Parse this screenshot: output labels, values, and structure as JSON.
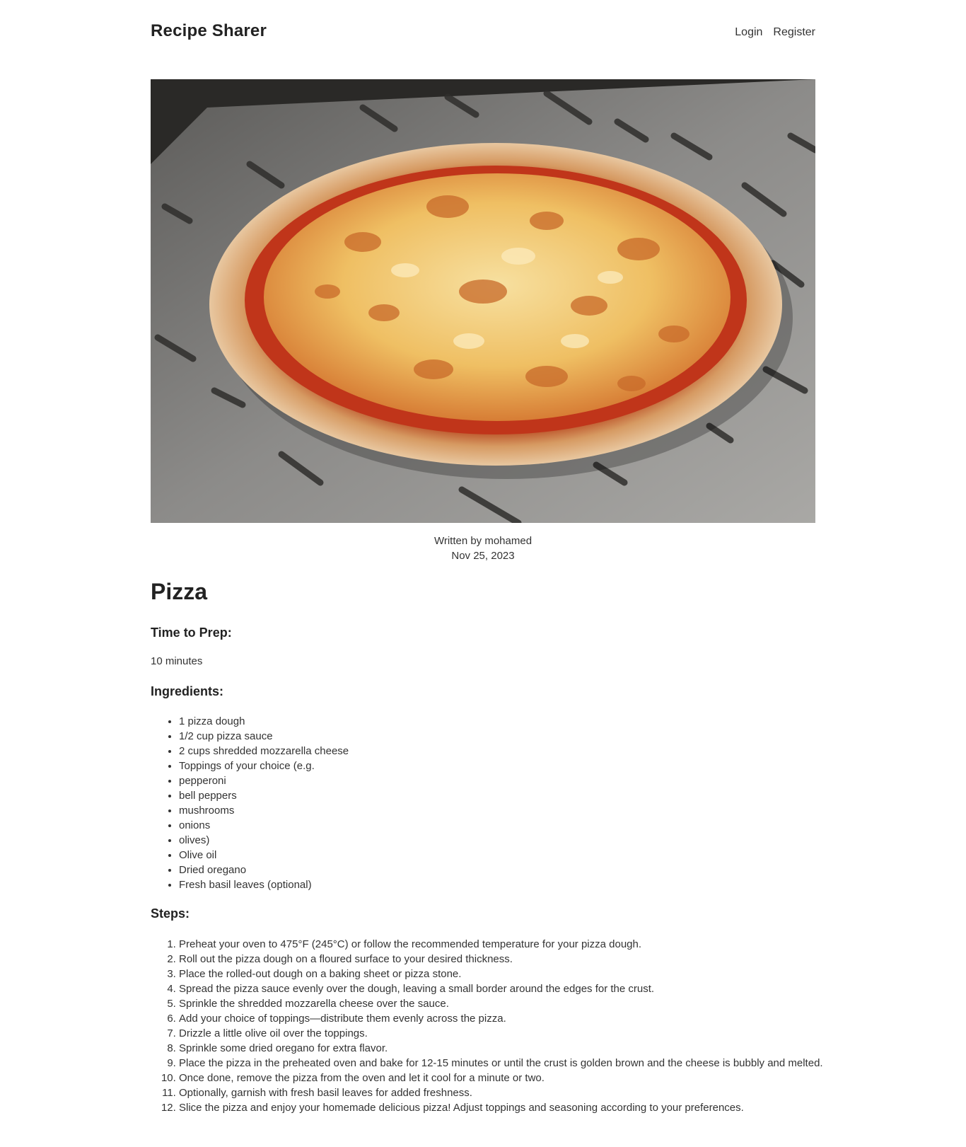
{
  "header": {
    "brand": "Recipe Sharer",
    "nav": {
      "login": "Login",
      "register": "Register"
    }
  },
  "recipe": {
    "image_alt": "Pizza",
    "author_line": "Written by mohamed",
    "date": "Nov 25, 2023",
    "title": "Pizza",
    "prep_heading": "Time to Prep:",
    "prep_time": "10 minutes",
    "ingredients_heading": "Ingredients:",
    "ingredients": [
      "1 pizza dough",
      "1/2 cup pizza sauce",
      "2 cups shredded mozzarella cheese",
      "Toppings of your choice (e.g.",
      "pepperoni",
      "bell peppers",
      "mushrooms",
      "onions",
      "olives)",
      "Olive oil",
      "Dried oregano",
      "Fresh basil leaves (optional)"
    ],
    "steps_heading": "Steps:",
    "steps": [
      "Preheat your oven to 475°F (245°C) or follow the recommended temperature for your pizza dough.",
      "Roll out the pizza dough on a floured surface to your desired thickness.",
      "Place the rolled-out dough on a baking sheet or pizza stone.",
      "Spread the pizza sauce evenly over the dough, leaving a small border around the edges for the crust.",
      "Sprinkle the shredded mozzarella cheese over the sauce.",
      "Add your choice of toppings—distribute them evenly across the pizza.",
      "Drizzle a little olive oil over the toppings.",
      "Sprinkle some dried oregano for extra flavor.",
      "Place the pizza in the preheated oven and bake for 12-15 minutes or until the crust is golden brown and the cheese is bubbly and melted.",
      "Once done, remove the pizza from the oven and let it cool for a minute or two.",
      "Optionally, garnish with fresh basil leaves for added freshness.",
      "Slice the pizza and enjoy your homemade delicious pizza! Adjust toppings and seasoning according to your preferences."
    ]
  },
  "colors": {
    "text": "#2b2b2b",
    "heading": "#222222",
    "crust": "#d9a46a",
    "sauce": "#c8371c",
    "cheese": "#f2c46a",
    "peel": "#8a8987"
  }
}
